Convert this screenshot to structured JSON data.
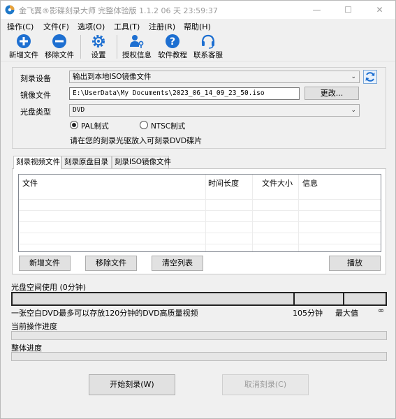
{
  "window": {
    "title": "金飞翼®影碟刻录大师 完整体验版 1.1.2 06 天 23:59:37",
    "minimize": "—",
    "maximize": "☐",
    "close": "✕"
  },
  "menu": [
    "操作(C)",
    "文件(F)",
    "选项(O)",
    "工具(T)",
    "注册(R)",
    "帮助(H)"
  ],
  "toolbar": {
    "add_file": "新增文件",
    "remove_file": "移除文件",
    "settings": "设置",
    "license": "授权信息",
    "tutorial": "软件教程",
    "support": "联系客服"
  },
  "setup": {
    "device_label": "刻录设备",
    "device_value": "输出到本地ISO镜像文件",
    "image_label": "镜像文件",
    "image_path": "E:\\UserData\\My Documents\\2023_06_14_09_23_50.iso",
    "change_button": "更改...",
    "disc_type_label": "光盘类型",
    "disc_type_value": "DVD",
    "pal_label": "PAL制式",
    "ntsc_label": "NTSC制式",
    "pal_selected": true,
    "hint": "请在您的刻录光驱放入可刻录DVD碟片"
  },
  "tabs": [
    "刻录视频文件",
    "刻录原盘目录",
    "刻录ISO镜像文件"
  ],
  "file_list": {
    "columns": [
      "文件",
      "时间长度",
      "文件大小",
      "信息"
    ],
    "rows": []
  },
  "list_buttons": {
    "add": "新增文件",
    "remove": "移除文件",
    "clear": "清空列表",
    "play": "播放"
  },
  "usage": {
    "label": "光盘空间使用 (0分钟)",
    "used_fraction": 0,
    "note": "一张空白DVD最多可以存放120分钟的DVD高质量视频",
    "mark_105": "105分钟",
    "mark_max": "最大值",
    "mark_inf": "∞"
  },
  "progress": {
    "current_label": "当前操作进度",
    "current_value": 0,
    "overall_label": "整体进度",
    "overall_value": 0
  },
  "actions": {
    "start": "开始刻录(W)",
    "cancel": "取消刻录(C)"
  }
}
